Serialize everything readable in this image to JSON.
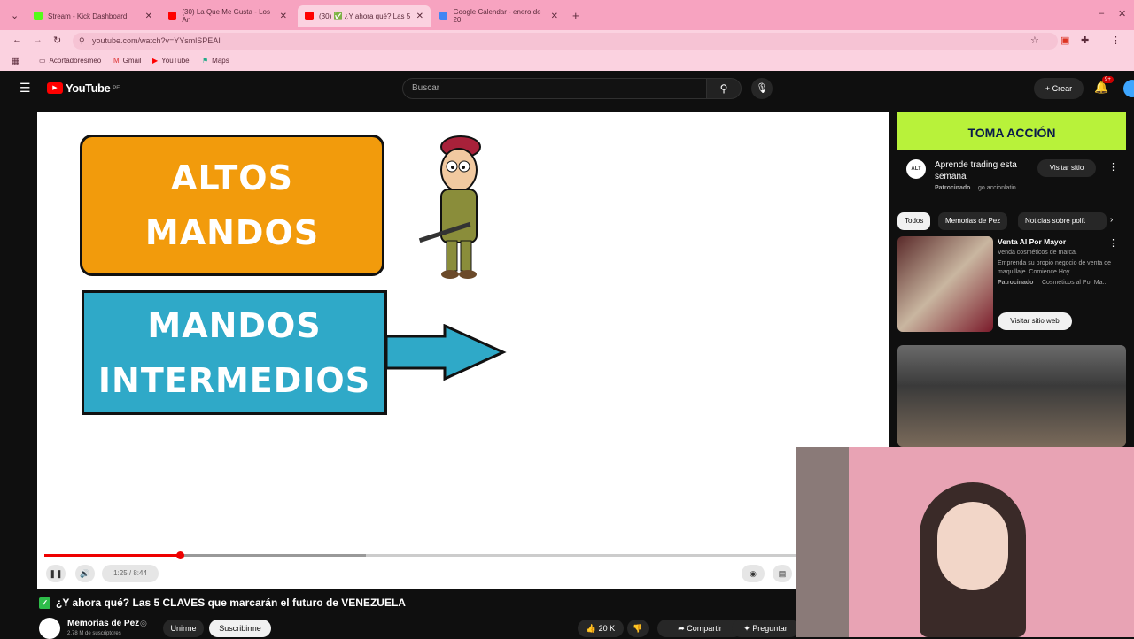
{
  "browser": {
    "tabs": [
      {
        "label": "Stream - Kick Dashboard",
        "color": "#53fc18"
      },
      {
        "label": "(30) La Que Me Gusta - Los An",
        "color": "#ff0000"
      },
      {
        "label": "(30) ✅ ¿Y ahora qué? Las 5",
        "color": "#ff0000"
      },
      {
        "label": "Google Calendar - enero de 20",
        "color": "#4285f4"
      }
    ],
    "url": "youtube.com/watch?v=YYsmlSPEAI",
    "bookmarks": [
      "Acortadoresmeo",
      "Gmail",
      "YouTube",
      "Maps"
    ]
  },
  "youtube": {
    "logo": "YouTube",
    "region": "PE",
    "search_placeholder": "Buscar",
    "create_label": "Crear",
    "notif_count": "9+"
  },
  "video": {
    "box1_line1": "ALTOS",
    "box1_line2": "MANDOS",
    "box2_line1": "MANDOS",
    "box2_line2": "INTERMEDIOS",
    "time": "1:25 / 8:44",
    "progress_played_fraction": 0.18,
    "title": "¿Y ahora qué? Las 5 CLAVES que marcarán el futuro de VENEZUELA",
    "channel": "Memorias de Pez",
    "subscribers": "2.78 M de suscriptores",
    "join_label": "Unirme",
    "subscribe_label": "Suscribirme",
    "likes": "20 K",
    "share_label": "Compartir",
    "ask_label": "Preguntar"
  },
  "sidebar": {
    "ad": {
      "banner_text": "TOMA ACCIÓN",
      "title": "Aprende trading esta semana",
      "sponsor": "Patrocinado",
      "domain": "go.accionlatin...",
      "button": "Visitar sitio",
      "avatar_text": "ALT"
    },
    "chips": [
      "Todos",
      "Memorias de Pez",
      "Noticias sobre polít"
    ],
    "ad2": {
      "title": "Venta Al Por Mayor",
      "desc1": "Venda cosméticos de marca.",
      "desc2": "Emprenda su propio negocio de venta de maquillaje. Comience Hoy",
      "sponsor": "Patrocinado",
      "domain": "Cosméticos al Por Ma...",
      "button": "Visitar sitio web"
    }
  }
}
